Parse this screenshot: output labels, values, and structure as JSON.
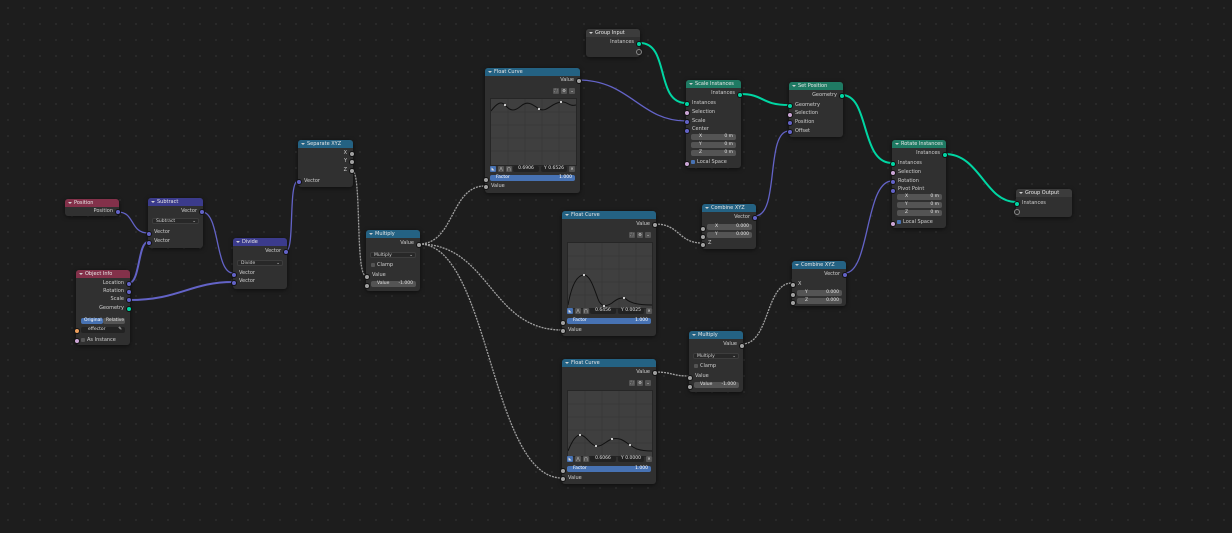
{
  "colors": {
    "background": "#1d1d1d",
    "node_body": "#303030",
    "header_input": "#83314a",
    "header_vector": "#3b3b8c",
    "header_converter": "#246283",
    "header_geometry": "#1f7a63",
    "socket_geometry": "#00d6a3",
    "socket_vector": "#6363c7",
    "socket_float": "#a1a1a1",
    "accent_blue": "#4772b3"
  },
  "nodes": {
    "position": {
      "title": "Position",
      "out_position": "Position"
    },
    "object_info": {
      "title": "Object Info",
      "out_location": "Location",
      "out_rotation": "Rotation",
      "out_scale": "Scale",
      "out_geometry": "Geometry",
      "btn_original": "Original",
      "btn_relative": "Relative",
      "object_value": "effector",
      "as_instance": "As Instance"
    },
    "subtract": {
      "title": "Subtract",
      "out_vector": "Vector",
      "operation": "Subtract",
      "in_vector_1": "Vector",
      "in_vector_2": "Vector"
    },
    "divide": {
      "title": "Divide",
      "out_vector": "Vector",
      "operation": "Divide",
      "in_vector_1": "Vector",
      "in_vector_2": "Vector"
    },
    "separate_xyz": {
      "title": "Separate XYZ",
      "out_x": "X",
      "out_y": "Y",
      "out_z": "Z",
      "in_vector": "Vector"
    },
    "multiply_1": {
      "title": "Multiply",
      "out_value": "Value",
      "operation": "Multiply",
      "clamp": "Clamp",
      "in_value": "Value",
      "value_label": "Value",
      "value": "-1.000"
    },
    "float_curve_1": {
      "title": "Float Curve",
      "out_value": "Value",
      "coord_x": "0.6906",
      "coord_y": "Y 0.6526",
      "factor_label": "Factor",
      "factor_value": "1.000",
      "in_value": "Value"
    },
    "float_curve_2": {
      "title": "Float Curve",
      "out_value": "Value",
      "coord_x": "0.6456",
      "coord_y": "Y 0.0025",
      "factor_label": "Factor",
      "factor_value": "1.000",
      "in_value": "Value"
    },
    "float_curve_3": {
      "title": "Float Curve",
      "out_value": "Value",
      "coord_x": "0.6066",
      "coord_y": "Y 0.0000",
      "factor_label": "Factor",
      "factor_value": "1.000",
      "in_value": "Value"
    },
    "group_input": {
      "title": "Group Input",
      "out_instances": "Instances"
    },
    "scale_instances": {
      "title": "Scale Instances",
      "out_instances": "Instances",
      "in_instances": "Instances",
      "in_selection": "Selection",
      "in_scale": "Scale",
      "in_center": "Center",
      "x_label": "X",
      "x_value": "0 m",
      "y_label": "Y",
      "y_value": "0 m",
      "z_label": "Z",
      "z_value": "0 m",
      "local_space": "Local Space"
    },
    "set_position": {
      "title": "Set Position",
      "out_geometry": "Geometry",
      "in_geometry": "Geometry",
      "in_selection": "Selection",
      "in_position": "Position",
      "in_offset": "Offset"
    },
    "combine_xyz_1": {
      "title": "Combine XYZ",
      "out_vector": "Vector",
      "x_label": "X",
      "x_value": "0.000",
      "y_label": "Y",
      "y_value": "0.000",
      "in_z": "Z"
    },
    "combine_xyz_2": {
      "title": "Combine XYZ",
      "out_vector": "Vector",
      "in_x": "X",
      "y_label": "Y",
      "y_value": "0.000",
      "z_label": "Z",
      "z_value": "0.000"
    },
    "multiply_2": {
      "title": "Multiply",
      "out_value": "Value",
      "operation": "Multiply",
      "clamp": "Clamp",
      "in_value": "Value",
      "value_label": "Value",
      "value": "-1.000"
    },
    "rotate_instances": {
      "title": "Rotate Instances",
      "out_instances": "Instances",
      "in_instances": "Instances",
      "in_selection": "Selection",
      "in_rotation": "Rotation",
      "in_pivot": "Pivot Point",
      "x_label": "X",
      "x_value": "0 m",
      "y_label": "Y",
      "y_value": "0 m",
      "z_label": "Z",
      "z_value": "0 m",
      "local_space": "Local Space"
    },
    "group_output": {
      "title": "Group Output",
      "in_instances": "Instances"
    }
  }
}
